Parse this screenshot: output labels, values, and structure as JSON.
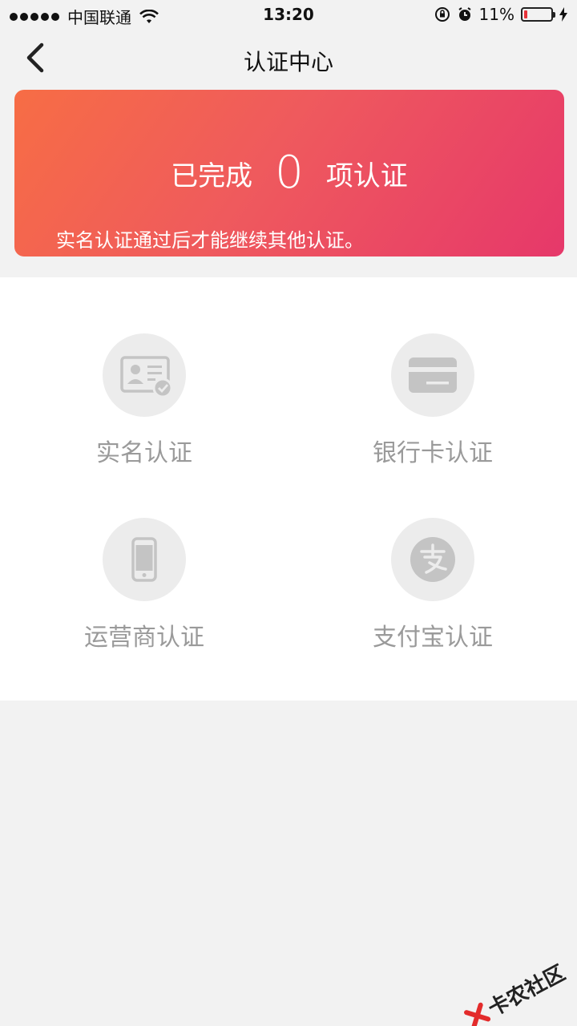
{
  "status_bar": {
    "carrier": "中国联通",
    "time": "13:20",
    "battery_percent": "11%",
    "battery_level": 0.11,
    "icons": [
      "signal-dots-icon",
      "wifi-icon",
      "rotation-lock-icon",
      "alarm-icon",
      "battery-icon",
      "charging-icon"
    ]
  },
  "nav": {
    "title": "认证中心",
    "back_icon": "chevron-left-icon"
  },
  "banner": {
    "prefix": "已完成",
    "count": "0",
    "suffix": "项认证",
    "hint": "实名认证通过后才能继续其他认证。",
    "colors": {
      "start": "#f76d45",
      "end": "#e6386a"
    }
  },
  "auth_items": [
    {
      "label": "实名认证",
      "icon": "id-card-icon"
    },
    {
      "label": "银行卡认证",
      "icon": "bank-card-icon"
    },
    {
      "label": "运营商认证",
      "icon": "mobile-phone-icon"
    },
    {
      "label": "支付宝认证",
      "icon": "alipay-icon"
    }
  ],
  "watermark": {
    "text": "卡农社区"
  }
}
